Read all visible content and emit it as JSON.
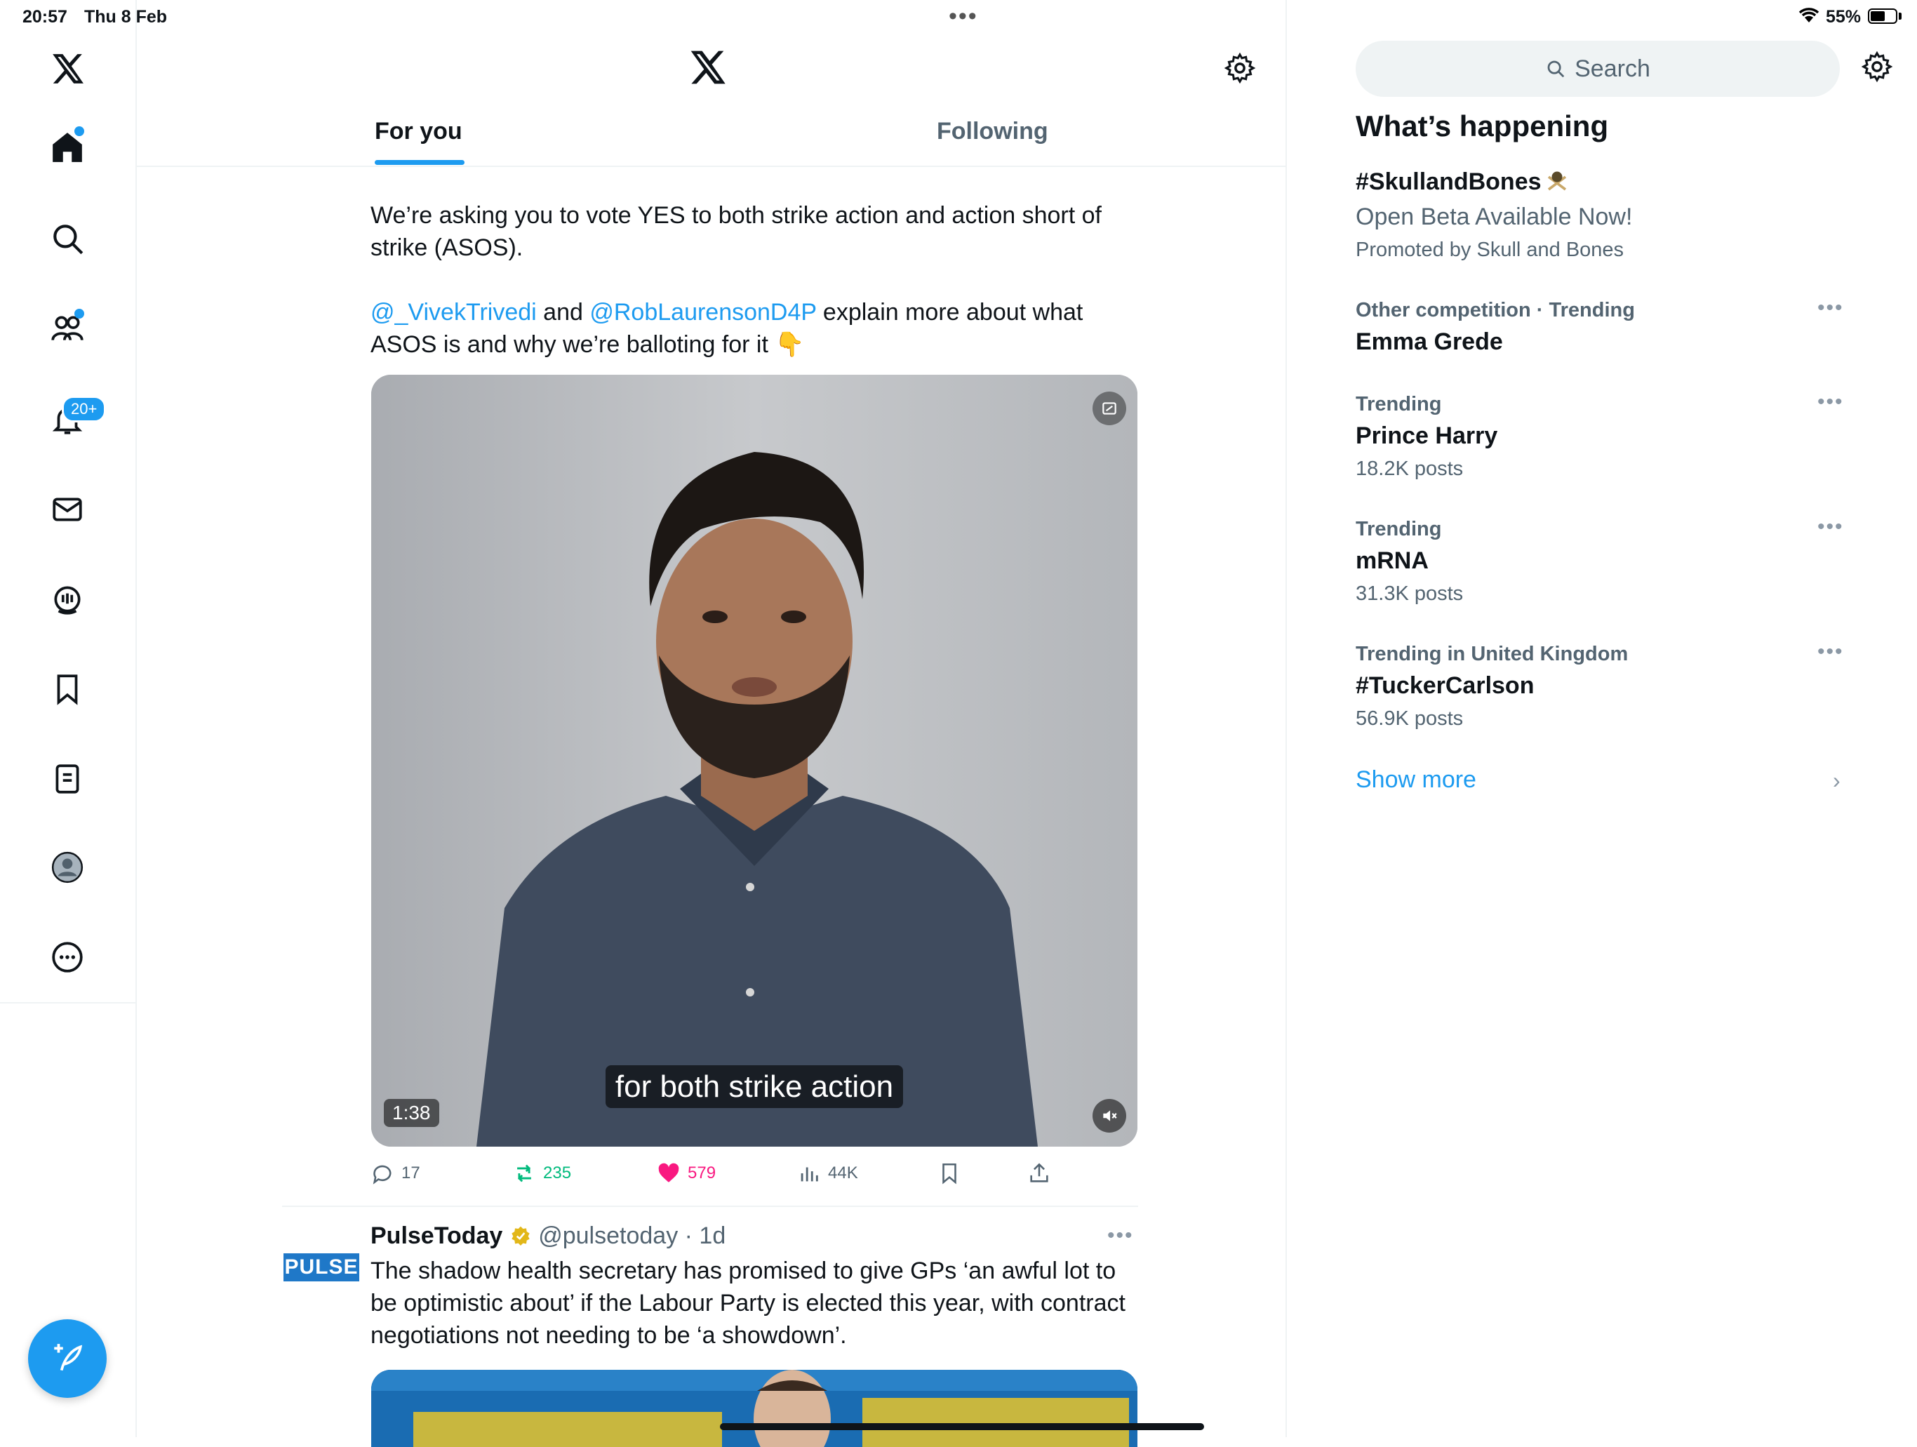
{
  "status_bar": {
    "time": "20:57",
    "date": "Thu 8 Feb",
    "battery": "55%"
  },
  "nav": {
    "notifications_badge": "20+"
  },
  "feed": {
    "tabs": [
      {
        "label": "For you"
      },
      {
        "label": "Following"
      }
    ],
    "tweet1": {
      "line1": "We’re asking you to vote YES to both strike action and action short of strike (ASOS).",
      "mention1": "@_VivekTrivedi",
      "and": "and",
      "mention2": "@RobLaurensonD4P",
      "line2_rest": "explain more about what ASOS is and why we’re balloting for it",
      "emoji": "👇",
      "video_caption": "for both strike action",
      "video_duration": "1:38",
      "stats": {
        "replies": "17",
        "reposts": "235",
        "likes": "579",
        "views": "44K"
      }
    },
    "tweet2": {
      "author": "PulseToday",
      "handle": "@pulsetoday",
      "time": "· 1d",
      "logo_text": "PULSE",
      "text": "The shadow health secretary has promised to give GPs ‘an awful lot to be optimistic about’ if the Labour Party is elected this year, with contract negotiations not needing to be ‘a showdown’."
    }
  },
  "sidebar": {
    "search_label": "Search",
    "title": "What’s happening",
    "promoted": {
      "name": "#SkullandBones",
      "subtitle": "Open Beta Available Now!",
      "promoted_by": "Promoted by Skull and Bones"
    },
    "trends": [
      {
        "meta": "Other competition · Trending",
        "name": "Emma Grede",
        "count": ""
      },
      {
        "meta": "Trending",
        "name": "Prince Harry",
        "count": "18.2K posts"
      },
      {
        "meta": "Trending",
        "name": "mRNA",
        "count": "31.3K posts"
      },
      {
        "meta": "Trending in United Kingdom",
        "name": "#TuckerCarlson",
        "count": "56.9K posts"
      }
    ],
    "show_more": "Show more"
  },
  "colors": {
    "accent": "#1d9bf0",
    "like": "#f91880",
    "repost": "#00ba7c",
    "muted": "#536471"
  }
}
